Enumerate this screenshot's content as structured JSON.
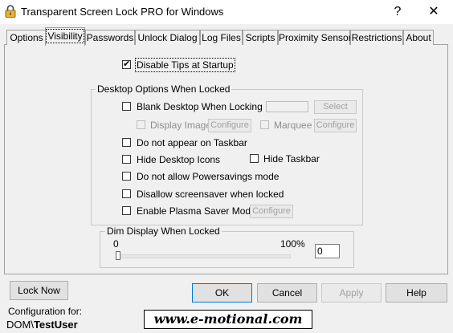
{
  "window": {
    "title": "Transparent Screen Lock PRO for Windows",
    "help_glyph": "?",
    "close_glyph": "✕"
  },
  "tabs": [
    {
      "label": "Options"
    },
    {
      "label": "Visibility",
      "active": true
    },
    {
      "label": "Passwords"
    },
    {
      "label": "Unlock Dialog"
    },
    {
      "label": "Log Files"
    },
    {
      "label": "Scripts"
    },
    {
      "label": "Proximity Sensor"
    },
    {
      "label": "Restrictions"
    },
    {
      "label": "About"
    }
  ],
  "visibility": {
    "disable_tips": {
      "label": "Disable Tips at Startup",
      "checked": true
    },
    "desktop_group": {
      "title": "Desktop Options When Locked",
      "blank_desktop": {
        "label": "Blank Desktop When Locking",
        "checked": false
      },
      "select_button": "Select",
      "display_image": {
        "label": "Display Image",
        "checked": false,
        "enabled": false
      },
      "configure_image_button": "Configure",
      "marquee": {
        "label": "Marquee",
        "checked": false,
        "enabled": false
      },
      "configure_marquee_button": "Configure",
      "no_taskbar_appear": {
        "label": "Do not appear on Taskbar",
        "checked": false
      },
      "hide_desktop_icons": {
        "label": "Hide Desktop Icons",
        "checked": false
      },
      "hide_taskbar": {
        "label": "Hide Taskbar",
        "checked": false
      },
      "no_powersavings": {
        "label": "Do not allow Powersavings mode",
        "checked": false
      },
      "disallow_screensaver": {
        "label": "Disallow screensaver when locked",
        "checked": false
      },
      "plasma_saver": {
        "label": "Enable Plasma Saver Mode",
        "checked": false
      },
      "configure_plasma_button": "Configure"
    },
    "dim_group": {
      "title": "Dim Display When Locked",
      "min_label": "0",
      "max_label": "100%",
      "value": 0,
      "value_text": "0"
    }
  },
  "footer": {
    "lock_now": "Lock Now",
    "ok": "OK",
    "cancel": "Cancel",
    "apply": "Apply",
    "help": "Help",
    "config_label": "Configuration for:",
    "config_user_prefix": "DOM\\",
    "config_user_name": "TestUser",
    "brand": "www.e-motional.com"
  },
  "colors": {
    "window_bg": "#f0f0f0",
    "accent": "#0078d7",
    "disabled_text": "#8d8d8d"
  },
  "icons": {
    "app": "padlock-icon",
    "checked": "checkmark-icon"
  }
}
